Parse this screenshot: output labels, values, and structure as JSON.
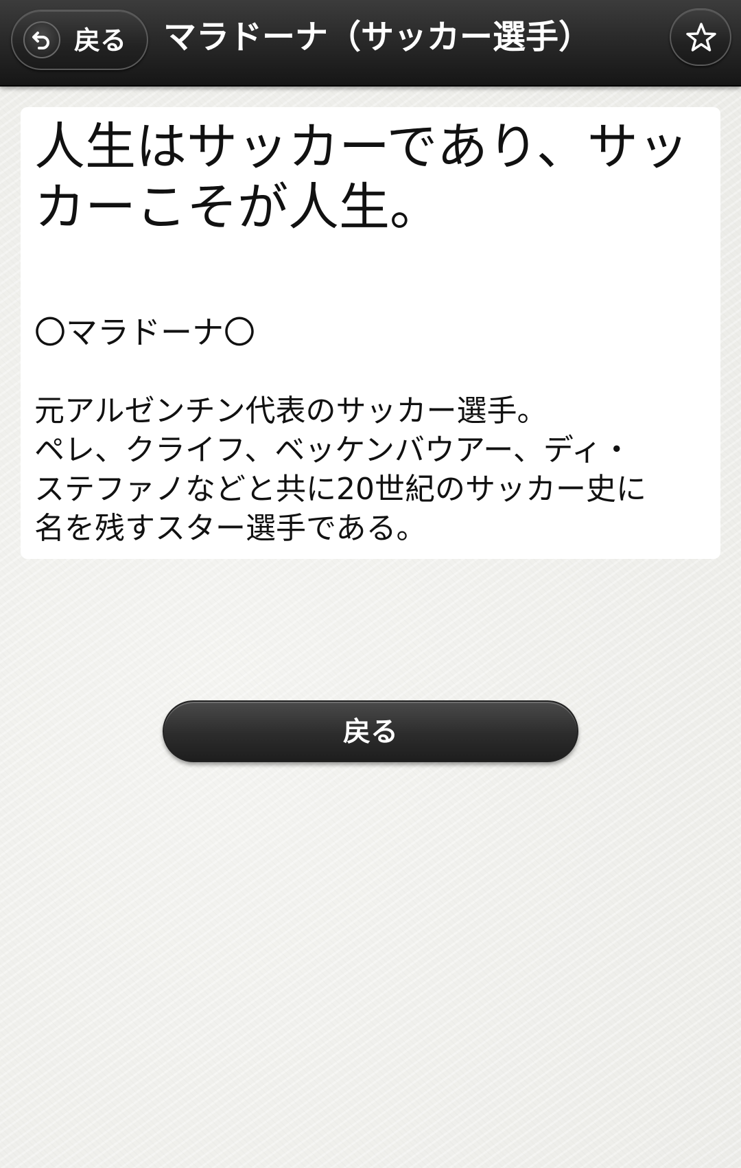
{
  "header": {
    "back_label": "戻る",
    "title": "マラドーナ（サッカー選手）",
    "back_icon": "undo-arrow-icon",
    "favorite_icon": "star-outline-icon"
  },
  "content": {
    "quote": "人生はサッカーであり、サッカーこそが人生。",
    "person": "〇マラドーナ〇",
    "description_lines": [
      "元アルゼンチン代表のサッカー選手。",
      "ペレ、クライフ、ベッケンバウアー、ディ・",
      "ステファノなどと共に20世紀のサッカー史に",
      "名を残すスター選手である。"
    ]
  },
  "footer": {
    "back_button_label": "戻る"
  }
}
